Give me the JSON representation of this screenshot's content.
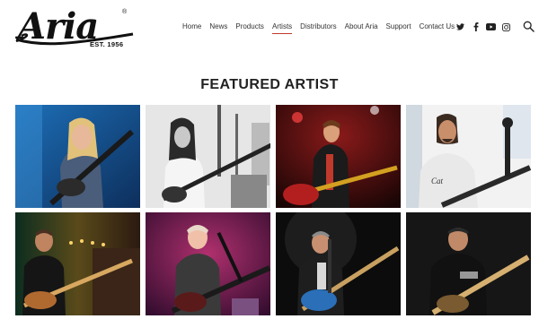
{
  "brand": {
    "name": "Aria",
    "registered": "®",
    "established": "EST. 1956"
  },
  "nav": {
    "items": [
      {
        "label": "Home",
        "active": false
      },
      {
        "label": "News",
        "active": false
      },
      {
        "label": "Products",
        "active": false
      },
      {
        "label": "Artists",
        "active": true
      },
      {
        "label": "Distributors",
        "active": false
      },
      {
        "label": "About Aria",
        "active": false
      },
      {
        "label": "Support",
        "active": false
      },
      {
        "label": "Contact Us",
        "active": false
      }
    ]
  },
  "social": [
    "twitter-icon",
    "facebook-icon",
    "youtube-icon",
    "instagram-icon"
  ],
  "search": {
    "icon": "search-icon"
  },
  "section": {
    "title": "FEATURED ARTIST"
  },
  "accent_color": "#c0392b",
  "artists": [
    {
      "photo": "long-haired guitarist performing, blue stage"
    },
    {
      "photo": "black and white guitarist with bass"
    },
    {
      "photo": "guitarist in red light with red guitar"
    },
    {
      "photo": "bearded bassist in white t-shirt"
    },
    {
      "photo": "bassist under warm stage lights"
    },
    {
      "photo": "smiling bassist in purple light"
    },
    {
      "photo": "guitarist in dark suit on stage"
    },
    {
      "photo": "bassist in black t-shirt, dark background"
    }
  ]
}
